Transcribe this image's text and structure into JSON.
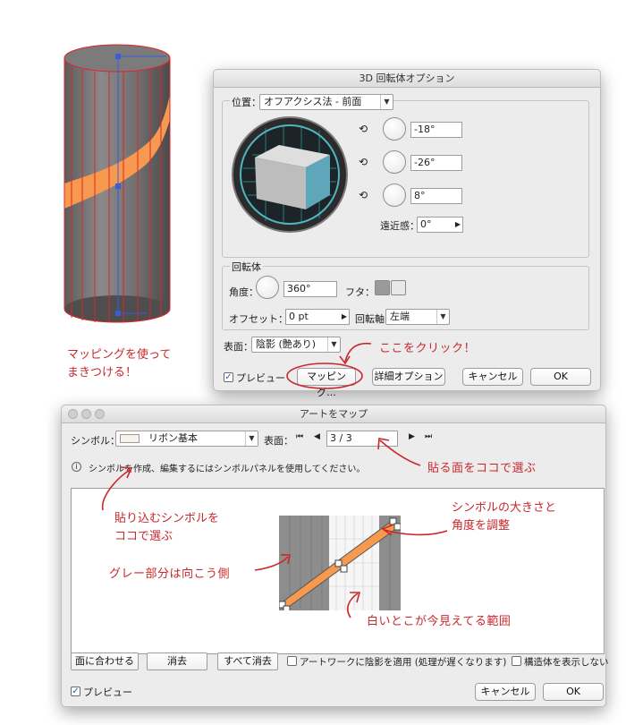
{
  "annotations": {
    "left_note_line1": "マッピングを使って",
    "left_note_line2": "まきつける！",
    "click_here": "ここをクリック！",
    "surface_select": "貼る面をココで選ぶ",
    "symbol_select_line1": "貼り込むシンボルを",
    "symbol_select_line2": "ココで選ぶ",
    "symbol_size_line1": "シンボルの大きさと",
    "symbol_size_line2": "角度を調整",
    "gray_area": "グレー部分は向こう側",
    "white_area": "白いとこが今見えてる範囲"
  },
  "dialog3d": {
    "title": "3D 回転体オプション",
    "position_label": "位置：",
    "position_value": "オフアクシス法 - 前面",
    "angle_x": "-18°",
    "angle_y": "-26°",
    "angle_z": "8°",
    "perspective_label": "遠近感：",
    "perspective_value": "0°",
    "revolve_group_title": "回転体",
    "angle_label": "角度：",
    "angle_value": "360°",
    "cap_label": "フタ：",
    "offset_label": "オフセット：",
    "offset_value": "0 pt",
    "axis_label": "回転軸",
    "axis_value": "左端",
    "surface_label": "表面：",
    "surface_value": "陰影 (艶あり)",
    "preview_label": "プレビュー",
    "mapping_button": "マッピング...",
    "more_options_button": "詳細オプション",
    "cancel_button": "キャンセル",
    "ok_button": "OK"
  },
  "map_dialog": {
    "title": "アートをマップ",
    "symbol_label": "シンボル：",
    "symbol_value": "リボン基本",
    "surface_label": "表面：",
    "surface_value": "3 / 3",
    "info_text": "シンボルを作成、編集するにはシンボルパネルを使用してください。",
    "fit_button": "面に合わせる",
    "clear_button": "消去",
    "clear_all_button": "すべて消去",
    "shade_artwork_label": "アートワークに陰影を適用 (処理が遅くなります)",
    "invisible_geometry_label": "構造体を表示しない",
    "preview_label": "プレビュー",
    "cancel_button": "キャンセル",
    "ok_button": "OK"
  },
  "colors": {
    "annotation": "#c8282d",
    "ribbon": "#f79a4f",
    "cube_face": "#5ea7bb",
    "wireframe": "#e0242b"
  }
}
